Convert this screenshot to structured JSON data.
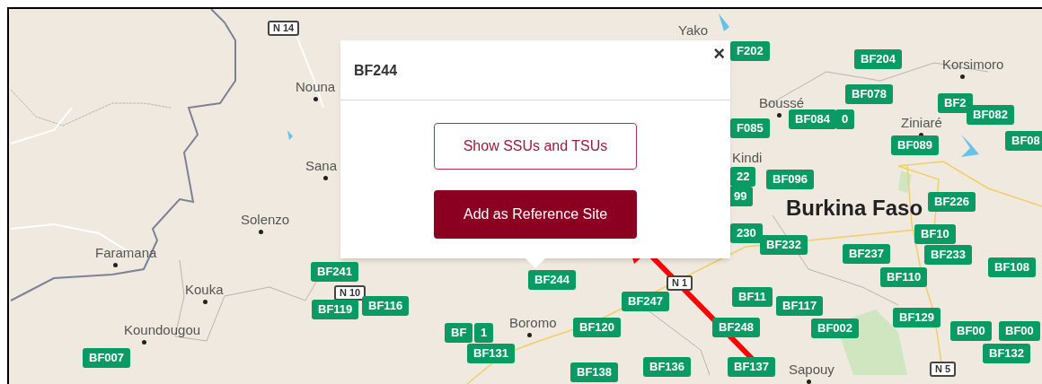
{
  "map": {
    "places": [
      {
        "name": "Nouna",
        "kind": "town"
      },
      {
        "name": "Sana",
        "kind": "town"
      },
      {
        "name": "Solenzo",
        "kind": "town"
      },
      {
        "name": "Faramana",
        "kind": "town"
      },
      {
        "name": "Kouka",
        "kind": "town"
      },
      {
        "name": "Koundougou",
        "kind": "town"
      },
      {
        "name": "Yako",
        "kind": "town"
      },
      {
        "name": "Korsimoro",
        "kind": "town"
      },
      {
        "name": "Boussé",
        "kind": "town"
      },
      {
        "name": "Ziniaré",
        "kind": "town"
      },
      {
        "name": "Kindi",
        "kind": "town"
      },
      {
        "name": "Boromo",
        "kind": "town"
      },
      {
        "name": "Burkina Faso",
        "kind": "country"
      },
      {
        "name": "Sapouy",
        "kind": "town"
      }
    ],
    "road_shields": [
      "N 14",
      "N 10",
      "N 1",
      "N 5"
    ],
    "markers": [
      {
        "label": "F202"
      },
      {
        "label": "BF204"
      },
      {
        "label": "BF078"
      },
      {
        "label": "BF2"
      },
      {
        "label": "BF082"
      },
      {
        "label": "BF08"
      },
      {
        "label": "F085"
      },
      {
        "label": "BF084"
      },
      {
        "label": "0"
      },
      {
        "label": "BF089"
      },
      {
        "label": "22"
      },
      {
        "label": "99"
      },
      {
        "label": "BF096"
      },
      {
        "label": "BF226"
      },
      {
        "label": "230"
      },
      {
        "label": "BF232"
      },
      {
        "label": "BF10"
      },
      {
        "label": "BF233"
      },
      {
        "label": "BF237"
      },
      {
        "label": "BF110"
      },
      {
        "label": "BF108"
      },
      {
        "label": "BF241"
      },
      {
        "label": "BF244"
      },
      {
        "label": "BF119"
      },
      {
        "label": "BF116"
      },
      {
        "label": "BF247"
      },
      {
        "label": "BF11"
      },
      {
        "label": "BF117"
      },
      {
        "label": "BF002"
      },
      {
        "label": "BF129"
      },
      {
        "label": "BF00"
      },
      {
        "label": "BF00"
      },
      {
        "label": "BF132"
      },
      {
        "label": "BF120"
      },
      {
        "label": "BF248"
      },
      {
        "label": "BF"
      },
      {
        "label": "1"
      },
      {
        "label": "BF131"
      },
      {
        "label": "BF007"
      },
      {
        "label": "BF138"
      },
      {
        "label": "BF136"
      },
      {
        "label": "BF137"
      }
    ]
  },
  "popup": {
    "title": "BF244",
    "close": "×",
    "buttons": [
      {
        "label": "Show SSUs and TSUs",
        "kind": "outline"
      },
      {
        "label": "Add as Reference Site",
        "kind": "filled"
      }
    ]
  }
}
